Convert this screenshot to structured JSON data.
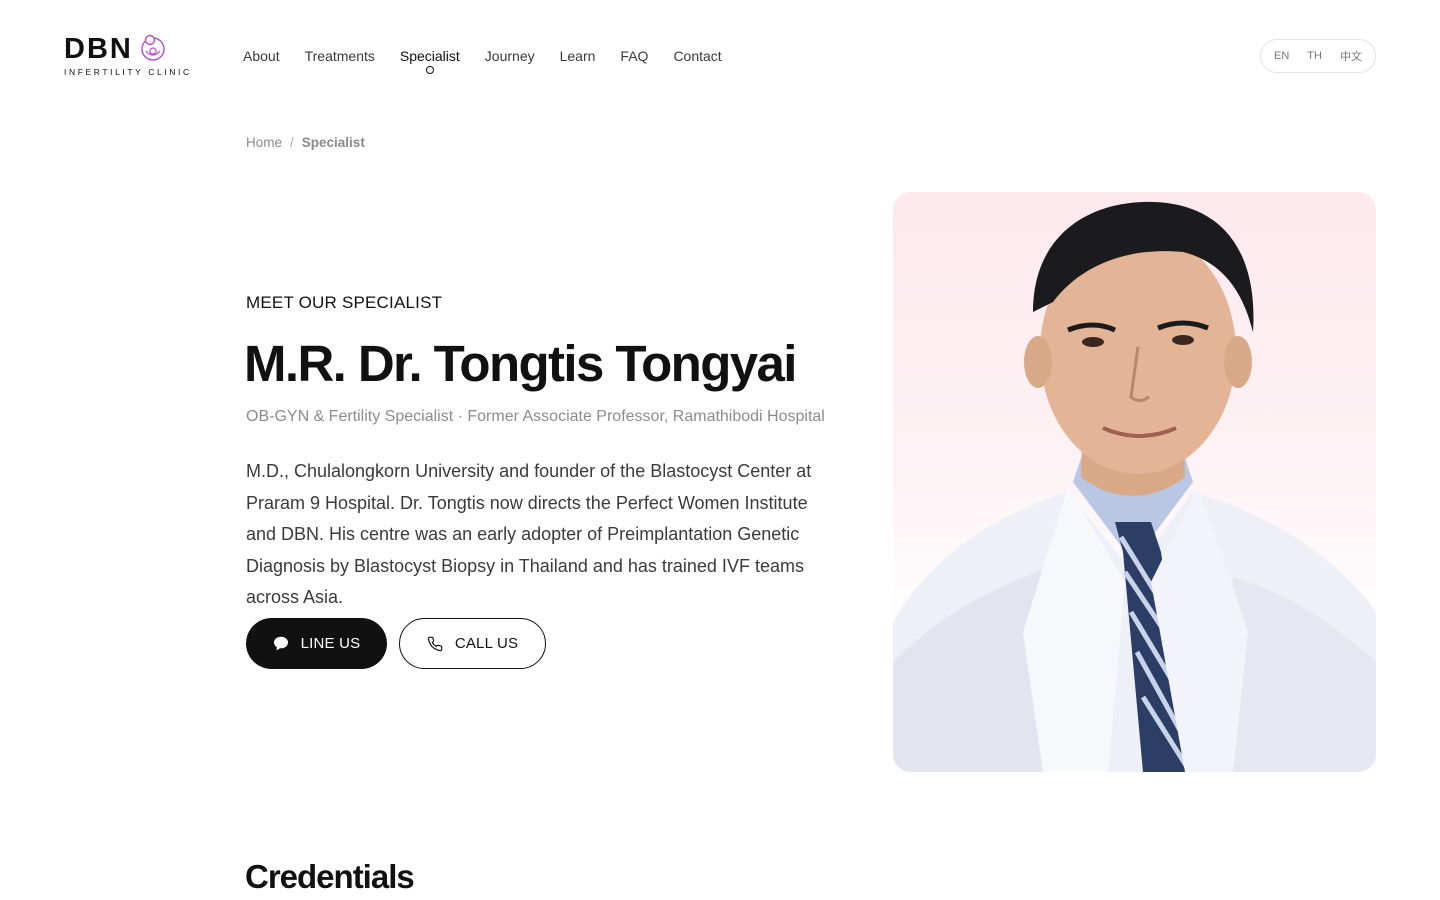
{
  "logo": {
    "wordmark": "DBN",
    "tagline": "INFERTILITY CLINIC",
    "accent_color": "#b44bd1"
  },
  "nav": {
    "items": [
      {
        "label": "About"
      },
      {
        "label": "Treatments"
      },
      {
        "label": "Specialist",
        "active": true
      },
      {
        "label": "Journey"
      },
      {
        "label": "Learn"
      },
      {
        "label": "FAQ"
      },
      {
        "label": "Contact"
      }
    ]
  },
  "language": {
    "options": [
      "EN",
      "TH",
      "中文"
    ]
  },
  "breadcrumb": {
    "home": "Home",
    "separator": "/",
    "current": "Specialist"
  },
  "hero": {
    "eyebrow": "MEET OUR SPECIALIST",
    "name": "M.R. Dr. Tongtis Tongyai",
    "subtitle": "OB-GYN & Fertility Specialist · Former Associate Professor, Ramathibodi Hospital",
    "bio": "M.D., Chulalongkorn University and founder of the Blastocyst Center at Praram 9 Hospital. Dr. Tongtis now directs the Perfect Women Institute and DBN. His centre was an early adopter of Preimplantation Genetic Diagnosis by Blastocyst Biopsy in Thailand and has trained IVF teams across Asia.",
    "line_button": "LINE US",
    "call_button": "CALL US",
    "line_icon": "chat-bubble-icon",
    "call_icon": "phone-icon"
  },
  "portrait": {
    "alt": "doctor-portrait",
    "background_color": "#fde9ee"
  },
  "credentials": {
    "title": "Credentials"
  }
}
